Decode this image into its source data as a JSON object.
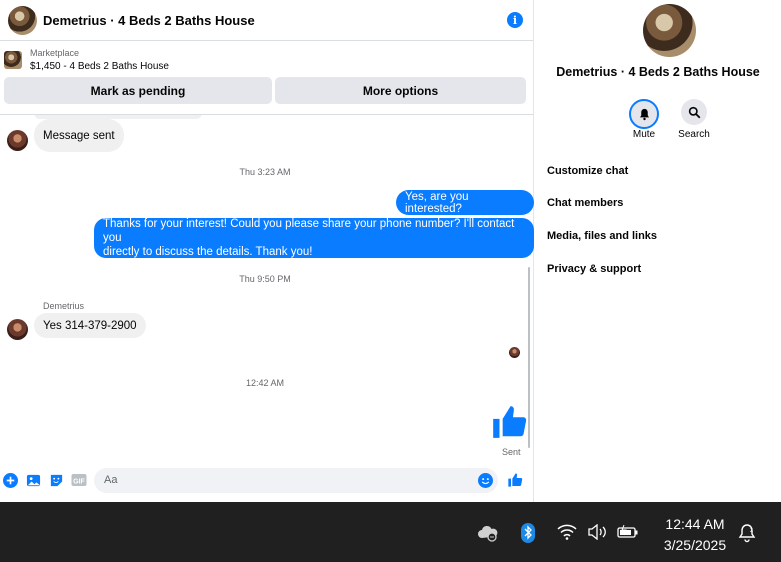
{
  "header": {
    "title": "Demetrius · 4 Beds 2 Baths House",
    "info_icon": "info-icon"
  },
  "marketplace": {
    "label": "Marketplace",
    "listing": "$1,450 - 4 Beds 2 Baths House",
    "buttons": {
      "pending": "Mark as pending",
      "more": "More options"
    }
  },
  "messages": [
    {
      "direction": "in",
      "text": "Message sent"
    },
    {
      "type": "timestamp",
      "text": "Thu 3:23 AM"
    },
    {
      "direction": "out",
      "text": "Yes, are you interested?"
    },
    {
      "direction": "out",
      "lines": [
        "Thanks for your interest! Could you please share your phone number? I'll contact you",
        "directly to discuss the details. Thank you!"
      ]
    },
    {
      "type": "timestamp",
      "text": "Thu 9:50 PM"
    },
    {
      "sender": "Demetrius"
    },
    {
      "direction": "in",
      "text": "Yes  314-379-2900"
    },
    {
      "type": "timestamp",
      "text": "12:42 AM"
    },
    {
      "direction": "out",
      "type": "like-sticker",
      "status": "Sent"
    }
  ],
  "composer": {
    "placeholder": "Aa"
  },
  "sidebar": {
    "title": "Demetrius · 4 Beds 2 Baths House",
    "actions": {
      "mute": "Mute",
      "search": "Search"
    },
    "items": [
      "Customize chat",
      "Chat members",
      "Media, files and links",
      "Privacy & support"
    ]
  },
  "taskbar": {
    "time": "12:44 AM",
    "date": "3/25/2025"
  },
  "colors": {
    "accent": "#0a7cff",
    "taskbar": "#202020",
    "bubble_in": "#f0f0f0"
  }
}
